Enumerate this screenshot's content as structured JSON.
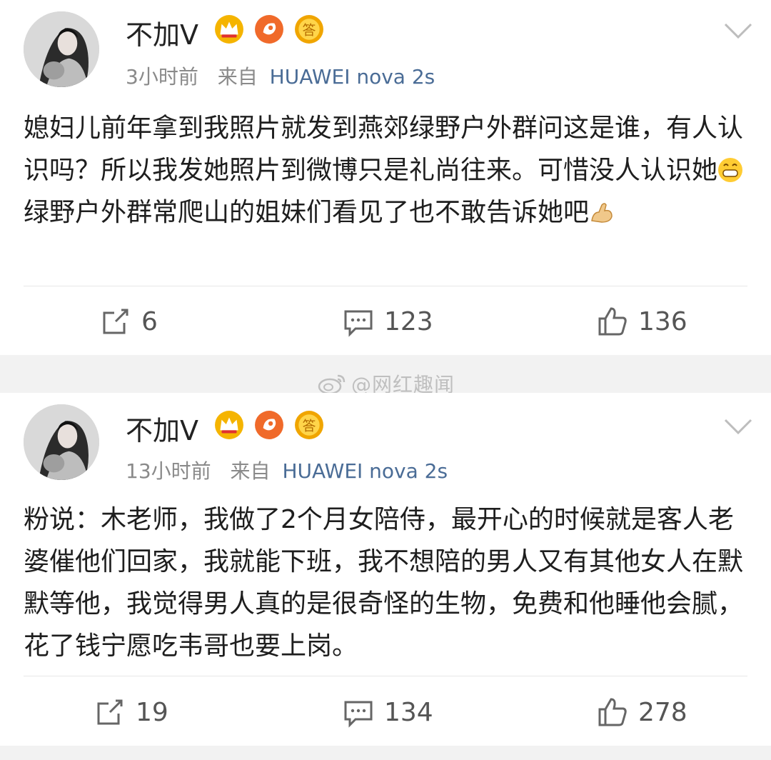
{
  "posts": [
    {
      "username": "不加V",
      "time": "3小时前",
      "source_prefix": "来自",
      "source": "HUAWEI nova 2s",
      "text_before_emoji": "媳妇儿前年拿到我照片就发到燕郊绿野户外群问这是谁，有人认识吗？所以我发她照片到微博只是礼尚往来。可惜没人认识她",
      "text_after_emoji": "绿野户外群常爬山的姐妹们看见了也不敢告诉她吧",
      "emoji": [
        "grin-emoji",
        "flex-emoji"
      ],
      "reposts": "6",
      "comments": "123",
      "likes": "136"
    },
    {
      "username": "不加V",
      "time": "13小时前",
      "source_prefix": "来自",
      "source": "HUAWEI nova 2s",
      "text": "粉说：木老师，我做了2个月女陪侍，最开心的时候就是客人老婆催他们回家，我就能下班，我不想陪的男人又有其他女人在默默等他，我觉得男人真的是很奇怪的生物，免费和他睡他会腻，花了钱宁愿吃韦哥也要上岗。",
      "reposts": "19",
      "comments": "134",
      "likes": "278"
    }
  ],
  "watermark": "@网红趣闻",
  "colors": {
    "source_link": "#4a6c96",
    "meta": "#8a8a8a",
    "card": "#ffffff",
    "gap": "#f2f2f2"
  }
}
